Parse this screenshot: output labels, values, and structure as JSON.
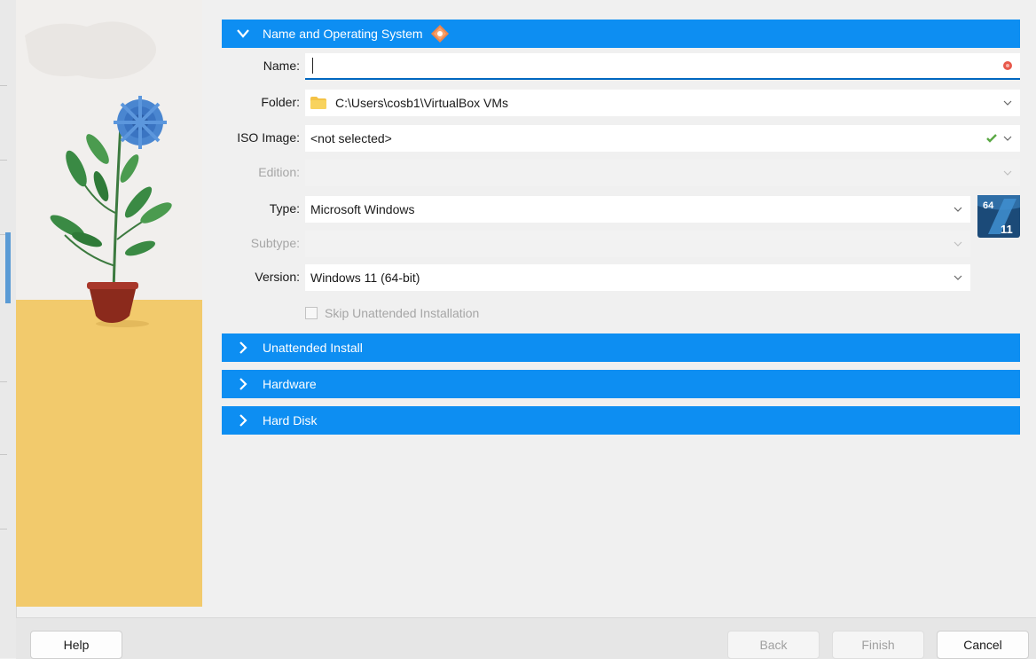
{
  "sections": {
    "name_os": {
      "label": "Name and Operating System",
      "expanded": true
    },
    "unattended": {
      "label": "Unattended Install",
      "expanded": false
    },
    "hardware": {
      "label": "Hardware",
      "expanded": false
    },
    "hard_disk": {
      "label": "Hard Disk",
      "expanded": false
    }
  },
  "form": {
    "name": {
      "label": "Name:",
      "value": ""
    },
    "folder": {
      "label": "Folder:",
      "value": "C:\\Users\\cosb1\\VirtualBox VMs"
    },
    "iso": {
      "label": "ISO Image:",
      "value": "<not selected>"
    },
    "edition": {
      "label": "Edition:",
      "value": ""
    },
    "type": {
      "label": "Type:",
      "value": "Microsoft Windows"
    },
    "subtype": {
      "label": "Subtype:",
      "value": ""
    },
    "version": {
      "label": "Version:",
      "value": "Windows 11 (64-bit)"
    },
    "skip_unattended": {
      "label": "Skip Unattended Installation",
      "checked": false
    }
  },
  "os_badge": {
    "icon": "windows-11-64bit-icon",
    "text_top": "64",
    "text_bottom": "11"
  },
  "buttons": {
    "help": "Help",
    "back": "Back",
    "finish": "Finish",
    "cancel": "Cancel"
  },
  "colors": {
    "section_header": "#0d8ef2",
    "focus": "#0067c0",
    "floor": "#f2ca6c"
  }
}
